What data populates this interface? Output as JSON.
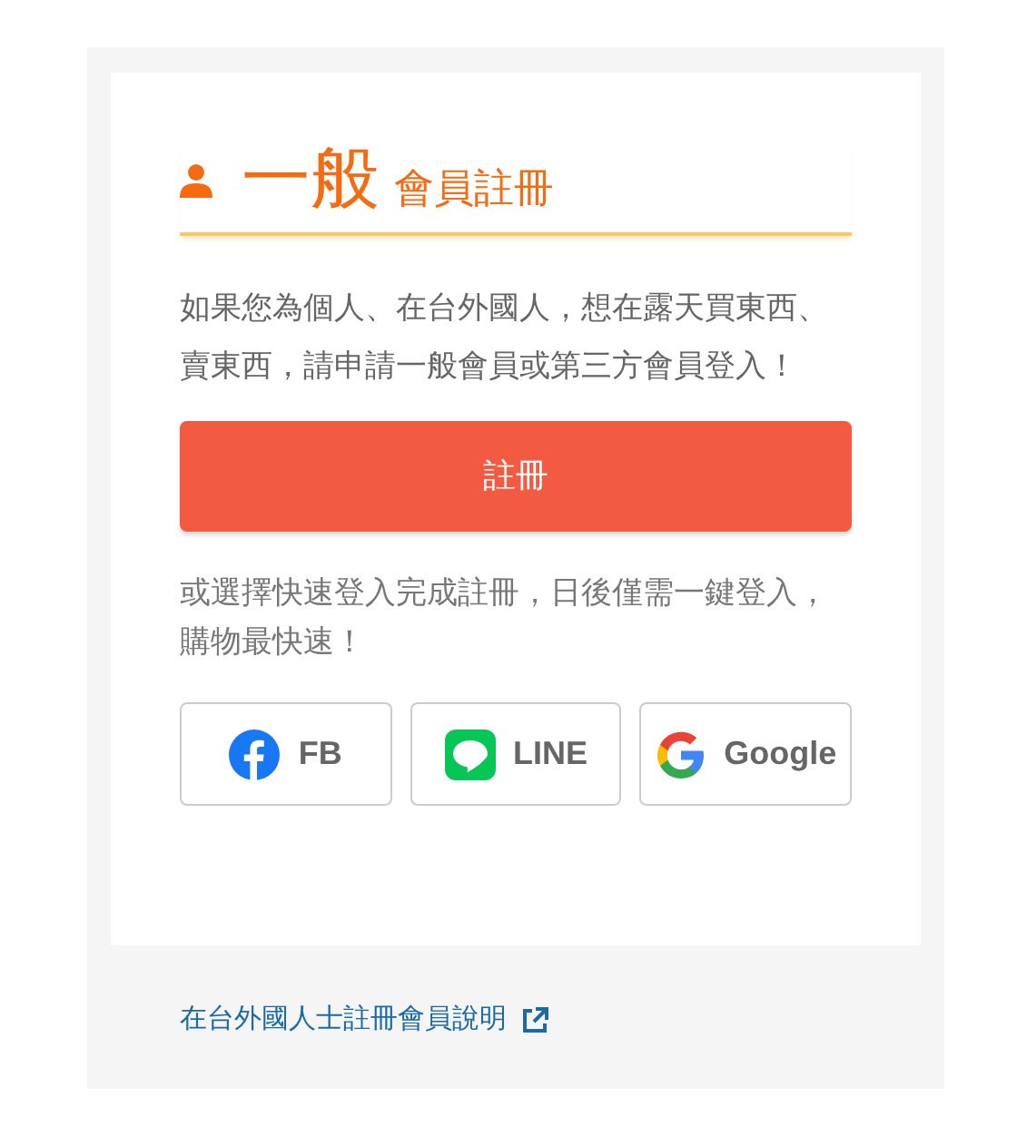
{
  "heading": {
    "big": "一般",
    "small": "會員註冊"
  },
  "intro": "如果您為個人、在台外國人，想在露天買東西、賣東西，請申請一般會員或第三方會員登入！",
  "register_button": "註冊",
  "quick_note": "或選擇快速登入完成註冊，日後僅需一鍵登入，購物最快速！",
  "social_buttons": [
    {
      "kind": "facebook",
      "label": "FB"
    },
    {
      "kind": "line",
      "label": "LINE"
    },
    {
      "kind": "google",
      "label": "Google"
    }
  ],
  "foreign_link": "在台外國人士註冊會員說明"
}
